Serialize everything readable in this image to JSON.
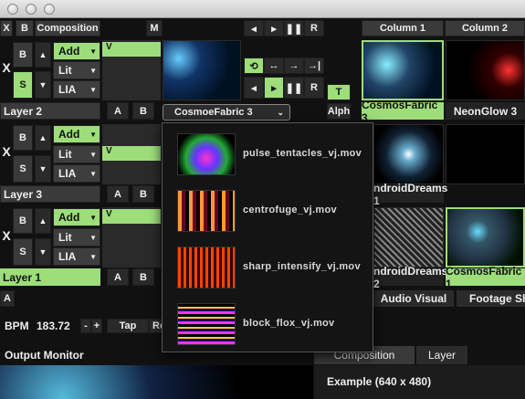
{
  "window": {
    "controls": [
      "close",
      "minimize",
      "zoom"
    ]
  },
  "top": {
    "x_label": "X",
    "b_label": "B",
    "composition_label": "Composition",
    "m_label": "M",
    "r_label": "R",
    "pause_icon": "pause-icon",
    "columns": [
      "Column 1",
      "Column 2"
    ]
  },
  "layers": [
    {
      "id": "layer2",
      "name": "Layer 2",
      "blend": "Add",
      "fx1": "Lit",
      "fx2": "LIA",
      "v": "V",
      "selected": false
    },
    {
      "id": "layer3",
      "name": "Layer 3",
      "blend": "Add",
      "fx1": "Lit",
      "fx2": "LIA",
      "v": "V",
      "selected": false
    },
    {
      "id": "layer1",
      "name": "Layer 1",
      "blend": "Add",
      "fx1": "Lit",
      "fx2": "LIA",
      "v": "V",
      "selected": true
    }
  ],
  "layer_controls": {
    "x": "X",
    "b": "B",
    "s": "S",
    "a": "A",
    "bb": "B"
  },
  "transport": {
    "t_label": "T",
    "alpha_label": "Alph",
    "r_label": "R"
  },
  "clip_select": {
    "value": "CosmoeFabric 3"
  },
  "clips": [
    {
      "name": "CosmosFabric 3",
      "selected": true
    },
    {
      "name": "NeonGlow 3",
      "selected": false
    },
    {
      "name": "ndroidDreams 1",
      "selected": false
    },
    {
      "name": "ndroidDreams 2",
      "selected": false
    },
    {
      "name": "CosmosFabric 1",
      "selected": true
    }
  ],
  "dropdown_items": [
    {
      "name": "pulse_tentacles_vj.mov"
    },
    {
      "name": "centrofuge_vj.mov"
    },
    {
      "name": "sharp_intensify_vj.mov"
    },
    {
      "name": "block_flox_vj.mov"
    }
  ],
  "bottom": {
    "a_label": "A",
    "bpm_label": "BPM",
    "bpm_value": "183.72",
    "minus": "-",
    "plus": "+",
    "tap": "Tap",
    "re": "Re",
    "output_monitor": "Output Monitor",
    "tabs": [
      "Audio Visual",
      "Footage Sh"
    ],
    "panel_tabs": [
      "Composition",
      "Layer"
    ],
    "example": "Example (640 x 480)"
  },
  "colors": {
    "accent": "#9ddd7a",
    "bg": "#111111",
    "button": "#3a3a3a"
  }
}
